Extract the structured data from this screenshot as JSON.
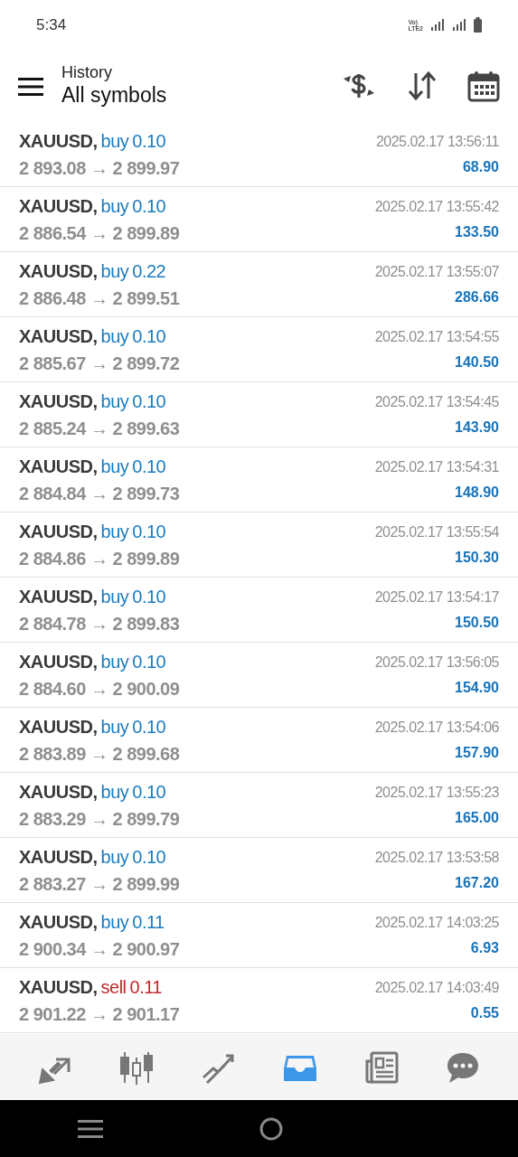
{
  "status_bar": {
    "time": "5:34",
    "network_label": [
      "Vo)",
      "LTE2"
    ]
  },
  "header": {
    "title": "History",
    "subtitle": "All symbols"
  },
  "deals": [
    {
      "symbol": "XAUUSD,",
      "side": "buy",
      "volume": "0.10",
      "prices": "2 893.08 → 2 899.97",
      "time": "2025.02.17 13:56:11",
      "profit": "68.90"
    },
    {
      "symbol": "XAUUSD,",
      "side": "buy",
      "volume": "0.10",
      "prices": "2 886.54 → 2 899.89",
      "time": "2025.02.17 13:55:42",
      "profit": "133.50"
    },
    {
      "symbol": "XAUUSD,",
      "side": "buy",
      "volume": "0.22",
      "prices": "2 886.48 → 2 899.51",
      "time": "2025.02.17 13:55:07",
      "profit": "286.66"
    },
    {
      "symbol": "XAUUSD,",
      "side": "buy",
      "volume": "0.10",
      "prices": "2 885.67 → 2 899.72",
      "time": "2025.02.17 13:54:55",
      "profit": "140.50"
    },
    {
      "symbol": "XAUUSD,",
      "side": "buy",
      "volume": "0.10",
      "prices": "2 885.24 → 2 899.63",
      "time": "2025.02.17 13:54:45",
      "profit": "143.90"
    },
    {
      "symbol": "XAUUSD,",
      "side": "buy",
      "volume": "0.10",
      "prices": "2 884.84 → 2 899.73",
      "time": "2025.02.17 13:54:31",
      "profit": "148.90"
    },
    {
      "symbol": "XAUUSD,",
      "side": "buy",
      "volume": "0.10",
      "prices": "2 884.86 → 2 899.89",
      "time": "2025.02.17 13:55:54",
      "profit": "150.30"
    },
    {
      "symbol": "XAUUSD,",
      "side": "buy",
      "volume": "0.10",
      "prices": "2 884.78 → 2 899.83",
      "time": "2025.02.17 13:54:17",
      "profit": "150.50"
    },
    {
      "symbol": "XAUUSD,",
      "side": "buy",
      "volume": "0.10",
      "prices": "2 884.60 → 2 900.09",
      "time": "2025.02.17 13:56:05",
      "profit": "154.90"
    },
    {
      "symbol": "XAUUSD,",
      "side": "buy",
      "volume": "0.10",
      "prices": "2 883.89 → 2 899.68",
      "time": "2025.02.17 13:54:06",
      "profit": "157.90"
    },
    {
      "symbol": "XAUUSD,",
      "side": "buy",
      "volume": "0.10",
      "prices": "2 883.29 → 2 899.79",
      "time": "2025.02.17 13:55:23",
      "profit": "165.00"
    },
    {
      "symbol": "XAUUSD,",
      "side": "buy",
      "volume": "0.10",
      "prices": "2 883.27 → 2 899.99",
      "time": "2025.02.17 13:53:58",
      "profit": "167.20"
    },
    {
      "symbol": "XAUUSD,",
      "side": "buy",
      "volume": "0.11",
      "prices": "2 900.34 → 2 900.97",
      "time": "2025.02.17 14:03:25",
      "profit": "6.93"
    },
    {
      "symbol": "XAUUSD,",
      "side": "sell",
      "volume": "0.11",
      "prices": "2 901.22 → 2 901.17",
      "time": "2025.02.17 14:03:49",
      "profit": "0.55"
    }
  ],
  "bottom_tabs": [
    {
      "kind": "trade",
      "selected": false
    },
    {
      "kind": "quotes",
      "selected": false
    },
    {
      "kind": "charts",
      "selected": false
    },
    {
      "kind": "history",
      "selected": true
    },
    {
      "kind": "news",
      "selected": false
    },
    {
      "kind": "messages",
      "selected": false
    }
  ]
}
